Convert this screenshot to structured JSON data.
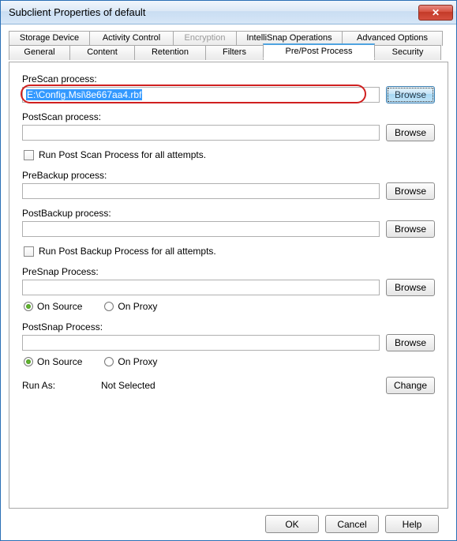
{
  "window": {
    "title": "Subclient Properties of default"
  },
  "tabs": {
    "row1": [
      {
        "label": "Storage Device"
      },
      {
        "label": "Activity Control"
      },
      {
        "label": "Encryption",
        "disabled": true
      },
      {
        "label": "IntelliSnap Operations"
      },
      {
        "label": "Advanced Options"
      }
    ],
    "row2": [
      {
        "label": "General"
      },
      {
        "label": "Content"
      },
      {
        "label": "Retention"
      },
      {
        "label": "Filters"
      },
      {
        "label": "Pre/Post Process",
        "active": true
      },
      {
        "label": "Security"
      }
    ]
  },
  "form": {
    "prescan": {
      "label": "PreScan process:",
      "value": "E:\\Config.Msi\\8e667aa4.rbf",
      "browse": "Browse"
    },
    "postscan": {
      "label": "PostScan process:",
      "value": "",
      "browse": "Browse"
    },
    "runPostScanAll": {
      "label": "Run Post Scan Process for all attempts.",
      "checked": false
    },
    "prebackup": {
      "label": "PreBackup process:",
      "value": "",
      "browse": "Browse"
    },
    "postbackup": {
      "label": "PostBackup process:",
      "value": "",
      "browse": "Browse"
    },
    "runPostBackupAll": {
      "label": "Run Post Backup Process for all attempts.",
      "checked": false
    },
    "presnap": {
      "label": "PreSnap Process:",
      "value": "",
      "browse": "Browse",
      "radio": {
        "onSource": "On Source",
        "onProxy": "On Proxy",
        "selected": "onSource"
      }
    },
    "postsnap": {
      "label": "PostSnap Process:",
      "value": "",
      "browse": "Browse",
      "radio": {
        "onSource": "On Source",
        "onProxy": "On Proxy",
        "selected": "onSource"
      }
    },
    "runAs": {
      "label": "Run As:",
      "value": "Not Selected",
      "change": "Change"
    }
  },
  "buttons": {
    "ok": "OK",
    "cancel": "Cancel",
    "help": "Help"
  }
}
